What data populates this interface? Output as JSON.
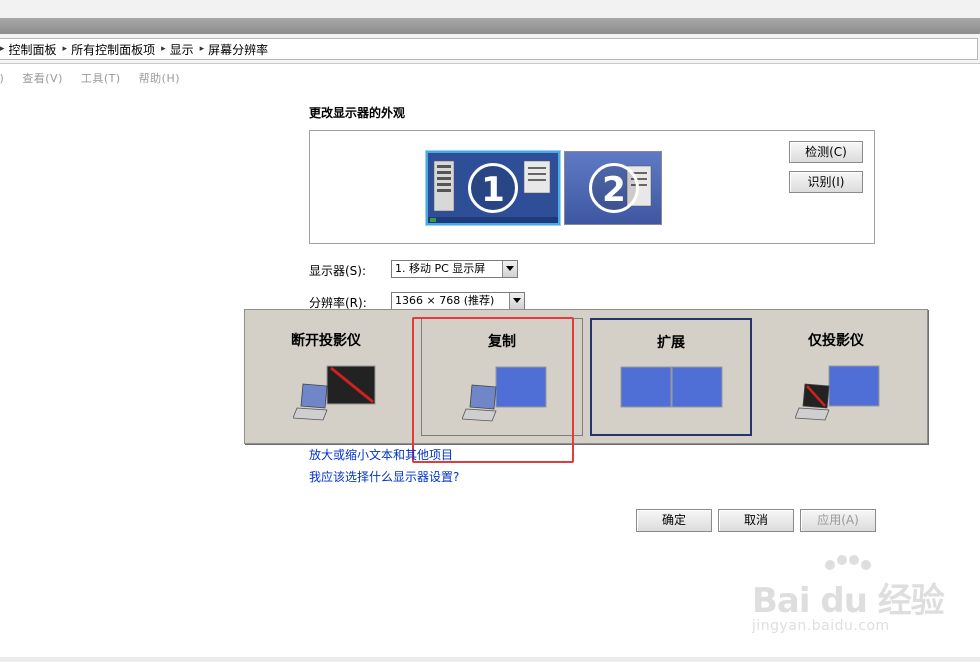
{
  "breadcrumb": [
    "控制面板",
    "所有控制面板项",
    "显示",
    "屏幕分辨率"
  ],
  "menu": {
    "edit": "E)",
    "view": "查看(V)",
    "tools": "工具(T)",
    "help": "帮助(H)"
  },
  "page": {
    "heading": "更改显示器的外观",
    "monitor1_number": "1",
    "monitor2_number": "2",
    "detect_label": "检测(C)",
    "identify_label": "识别(I)",
    "display_label": "显示器(S):",
    "display_value": "1. 移动 PC 显示屏",
    "resolution_label": "分辨率(R):",
    "resolution_value": "1366 × 768 (推荐)"
  },
  "projection": {
    "options": [
      {
        "label": "断开投影仪"
      },
      {
        "label": "复制"
      },
      {
        "label": "扩展"
      },
      {
        "label": "仅投影仪"
      }
    ]
  },
  "links": {
    "text_size": "放大或缩小文本和其他项目",
    "which_setting": "我应该选择什么显示器设置?"
  },
  "buttons": {
    "ok": "确定",
    "cancel": "取消",
    "apply": "应用(A)"
  },
  "watermark": {
    "main": "Bai du 经验",
    "sub": "jingyan.baidu.com"
  },
  "colors": {
    "accent_blue": "#3f57a2",
    "highlight_red": "#e23b3b",
    "link_blue": "#0033cc",
    "dialog_bg": "#d4d0c8"
  }
}
